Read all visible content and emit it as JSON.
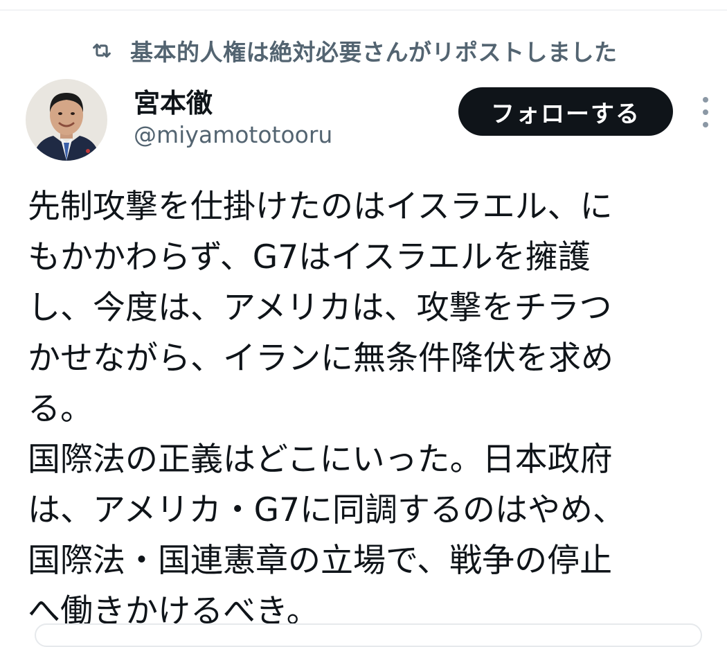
{
  "repost": {
    "icon": "repost-icon",
    "label": "基本的人権は絶対必要さんがリポストしました"
  },
  "author": {
    "avatar_icon": "avatar-photo",
    "name": "宮本徹",
    "handle": "@miyamototooru"
  },
  "actions": {
    "follow_label": "フォローする",
    "more_icon": "more-vertical-icon"
  },
  "tweet": {
    "lines": [
      "先制攻撃を仕掛けたのはイスラエル、に",
      "もかかわらず、G7はイスラエルを擁護",
      "し、今度は、アメリカは、攻撃をチラつ",
      "かせながら、イランに無条件降伏を求め",
      "る。",
      "国際法の正義はどこにいった。日本政府",
      "は、アメリカ・G7に同調するのはやめ、",
      "国際法・国連憲章の立場で、戦争の停止",
      "へ働きかけるべき。"
    ]
  },
  "colors": {
    "text_primary": "#0f1419",
    "text_secondary": "#536471",
    "follow_bg": "#0f1419",
    "follow_text": "#ffffff"
  }
}
